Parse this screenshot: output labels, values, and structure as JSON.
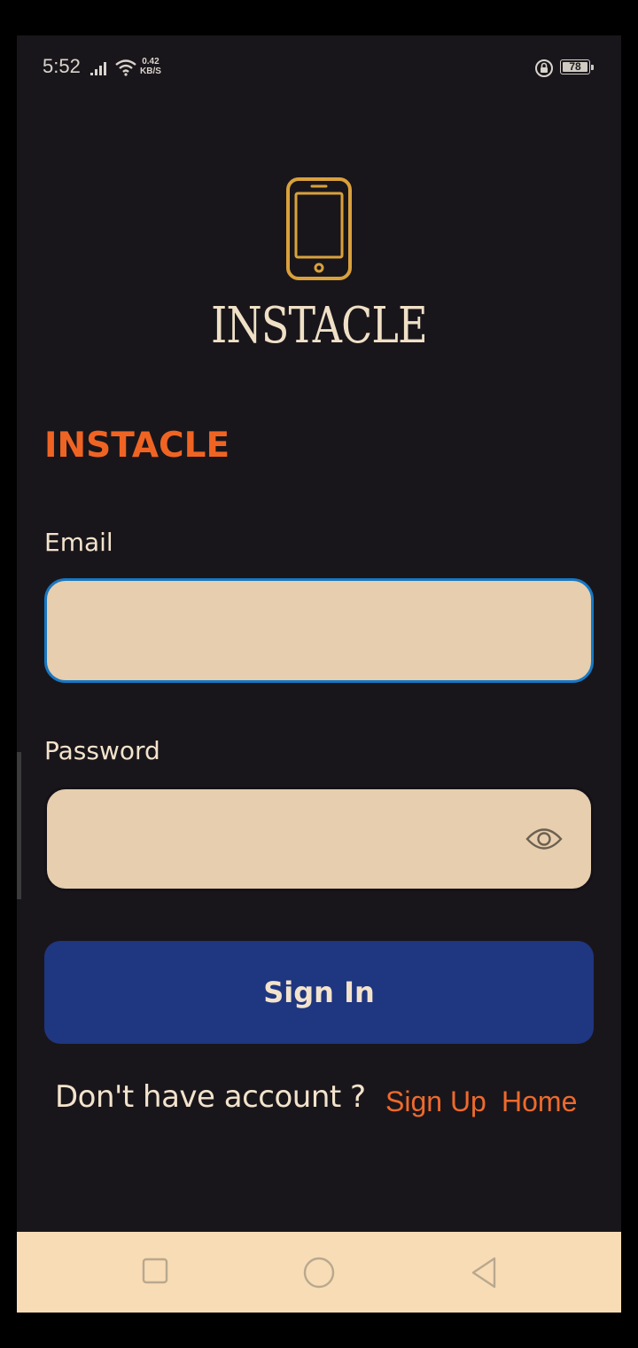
{
  "status_bar": {
    "time": "5:52",
    "speed_value": "0.42",
    "speed_unit": "KB/S",
    "battery": "78",
    "icons": [
      "signal-icon",
      "wifi-icon",
      "screen-lock-icon",
      "battery-icon"
    ]
  },
  "logo": {
    "icon": "smartphone-icon",
    "text": "INSTACLE",
    "color": "#d9a13c"
  },
  "form": {
    "title": "INSTACLE",
    "email_label": "Email",
    "email_value": "",
    "password_label": "Password",
    "password_value": "",
    "password_toggle_icon": "eye-icon",
    "submit_label": "Sign In"
  },
  "footer": {
    "prompt": "Don't have account ?",
    "signup_link": "Sign Up",
    "home_link": "Home"
  },
  "colors": {
    "background": "#19161b",
    "accent": "#f06423",
    "field_bg": "#e6ceae",
    "button_bg": "#1f3680",
    "focus_border": "#1778c4",
    "navbar_bg": "#f7dcb5"
  },
  "nav_bar": {
    "buttons": [
      "recents-icon",
      "home-circle-icon",
      "back-triangle-icon"
    ]
  }
}
